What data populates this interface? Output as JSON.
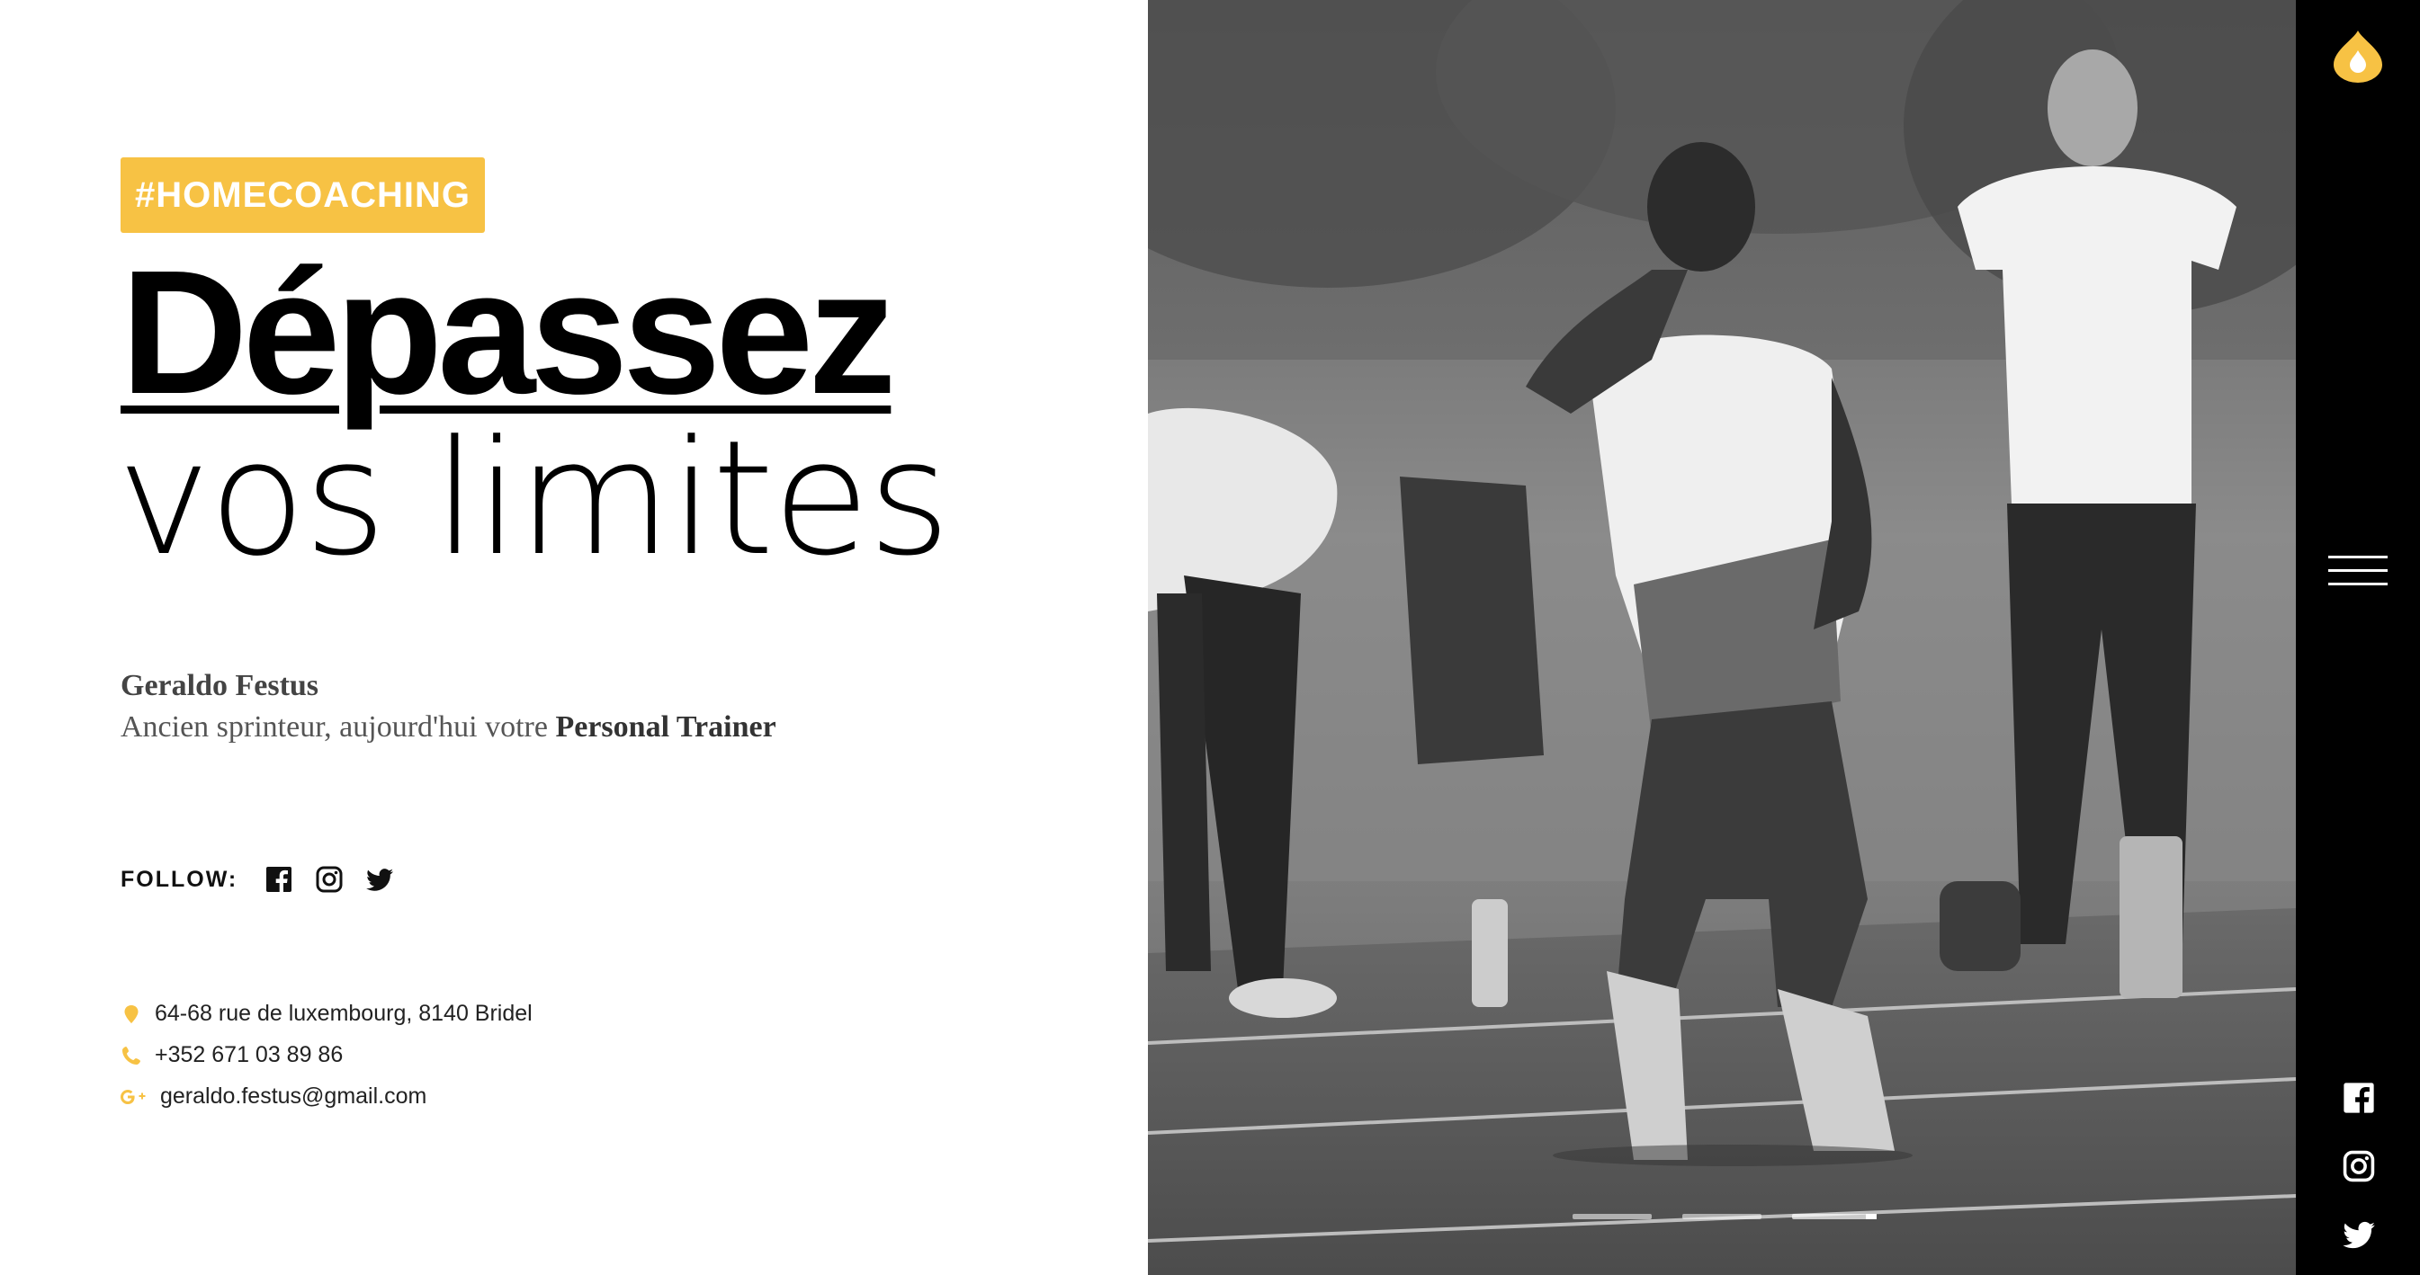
{
  "hero": {
    "tag": "#HOMECOACHING",
    "headline_bold": "Dépassez",
    "headline_light": "vos limites"
  },
  "trainer": {
    "name": "Geraldo Festus",
    "subtitle_prefix": "Ancien sprinteur, aujourd'hui votre ",
    "subtitle_bold": "Personal Trainer"
  },
  "follow": {
    "label": "FOLLOW:",
    "icons": [
      "facebook-icon",
      "instagram-icon",
      "twitter-icon"
    ]
  },
  "contact": {
    "address": "64-68 rue de luxembourg, 8140 Bridel",
    "phone": "+352 671 03 89 86",
    "email": "geraldo.festus@gmail.com"
  },
  "slider": {
    "count": 3,
    "active_index": 2
  },
  "sidebar": {
    "icons": [
      "logo-drop-icon",
      "menu-icon",
      "facebook-icon",
      "instagram-icon",
      "twitter-icon"
    ]
  },
  "colors": {
    "accent": "#f7c244",
    "sidebar_bg": "#000000",
    "text": "#111111"
  }
}
